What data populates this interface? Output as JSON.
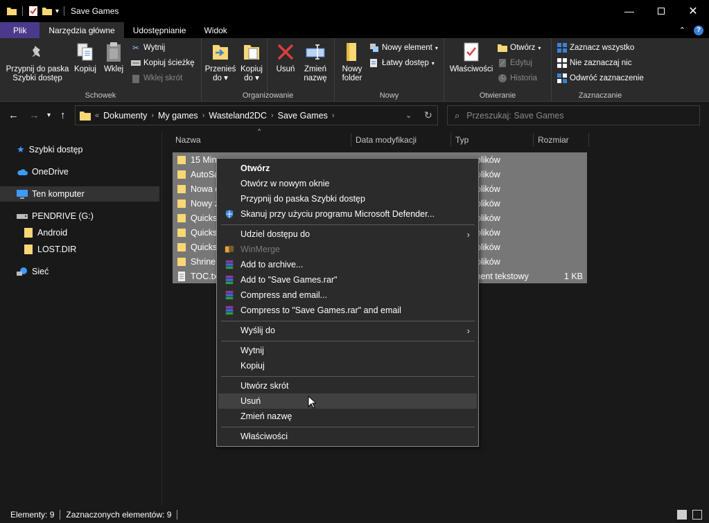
{
  "window": {
    "title": "Save Games"
  },
  "tabs": [
    {
      "label": "Plik"
    },
    {
      "label": "Narzędzia główne"
    },
    {
      "label": "Udostępnianie"
    },
    {
      "label": "Widok"
    }
  ],
  "ribbon": {
    "schowek": {
      "label": "Schowek",
      "pin": "Przypnij do paska Szybki dostęp",
      "pin_line1": "Przypnij do paska",
      "pin_line2": "Szybki dostęp",
      "copy": "Kopiuj",
      "paste": "Wklej",
      "cut": "Wytnij",
      "copy_path": "Kopiuj ścieżkę",
      "paste_shortcut": "Wklej skrót"
    },
    "organizowanie": {
      "label": "Organizowanie",
      "move_to_line1": "Przenieś",
      "move_to_line2": "do",
      "copy_to_line1": "Kopiuj",
      "copy_to_line2": "do",
      "delete": "Usuń",
      "rename_line1": "Zmień",
      "rename_line2": "nazwę"
    },
    "nowy": {
      "label": "Nowy",
      "new_folder_line1": "Nowy",
      "new_folder_line2": "folder",
      "new_item": "Nowy element",
      "easy_access": "Łatwy dostęp"
    },
    "otwieranie": {
      "label": "Otwieranie",
      "properties": "Właściwości",
      "open": "Otwórz",
      "edit": "Edytuj",
      "history": "Historia"
    },
    "zaznaczanie": {
      "label": "Zaznaczanie",
      "select_all": "Zaznacz wszystko",
      "select_none": "Nie zaznaczaj nic",
      "invert": "Odwróć zaznaczenie"
    }
  },
  "address": {
    "overflow": "«",
    "crumbs": [
      "Dokumenty",
      "My games",
      "Wasteland2DC",
      "Save Games"
    ],
    "search_placeholder": "Przeszukaj: Save Games"
  },
  "navpane": {
    "items": [
      {
        "label": "Szybki dostęp"
      },
      {
        "label": "OneDrive"
      },
      {
        "label": "Ten komputer"
      },
      {
        "label": "PENDRIVE (G:)"
      },
      {
        "label": "Android"
      },
      {
        "label": "LOST.DIR"
      },
      {
        "label": "Sieć"
      }
    ]
  },
  "columns": {
    "name": "Nazwa",
    "date": "Data modyfikacji",
    "type": "Typ",
    "size": "Rozmiar"
  },
  "files": [
    {
      "name": "15 Minu",
      "type": "plików",
      "size": ""
    },
    {
      "name": "AutoSa",
      "type": "plików",
      "size": ""
    },
    {
      "name": "Nowa d",
      "type": "plików",
      "size": ""
    },
    {
      "name": "Nowy z",
      "type": "plików",
      "size": ""
    },
    {
      "name": "Quicksa",
      "type": "plików",
      "size": ""
    },
    {
      "name": "Quicksa",
      "type": "plików",
      "size": ""
    },
    {
      "name": "Quicksa",
      "type": "plików",
      "size": ""
    },
    {
      "name": "Shrine",
      "type": "plików",
      "size": ""
    },
    {
      "name": "TOC.txt",
      "type": "ment tekstowy",
      "size": "1 KB"
    }
  ],
  "context_menu": {
    "open": "Otwórz",
    "open_new_window": "Otwórz w nowym oknie",
    "pin_quick": "Przypnij do paska Szybki dostęp",
    "scan": "Skanuj przy użyciu programu Microsoft Defender...",
    "share": "Udziel dostępu do",
    "winmerge": "WinMerge",
    "add_archive": "Add to archive...",
    "add_rar": "Add to \"Save Games.rar\"",
    "compress_email": "Compress and email...",
    "compress_rar_email": "Compress to \"Save Games.rar\" and email",
    "send_to": "Wyślij do",
    "cut": "Wytnij",
    "copy": "Kopiuj",
    "create_shortcut": "Utwórz skrót",
    "delete": "Usuń",
    "rename": "Zmień nazwę",
    "properties": "Właściwości"
  },
  "status": {
    "elements": "Elementy: 9",
    "selected": "Zaznaczonych elementów: 9"
  },
  "colors": {
    "file_tab": "#4b3a8b",
    "folder": "#f8d775",
    "selection": "#777777",
    "menu_bg": "#2b2b2b"
  }
}
